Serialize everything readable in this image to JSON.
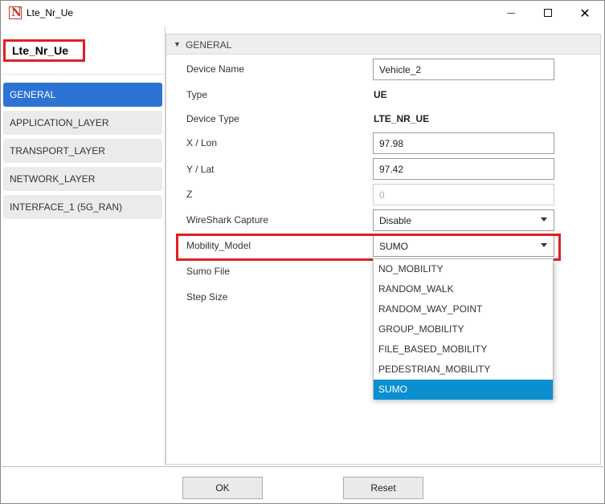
{
  "window": {
    "title": "Lte_Nr_Ue",
    "app_icon_letter": "N",
    "controls": {
      "minimize": "minimize",
      "maximize": "maximize",
      "close": "✕"
    }
  },
  "sidebar": {
    "device_title": "Lte_Nr_Ue",
    "items": [
      {
        "label": "GENERAL",
        "active": true
      },
      {
        "label": "APPLICATION_LAYER",
        "active": false
      },
      {
        "label": "TRANSPORT_LAYER",
        "active": false
      },
      {
        "label": "NETWORK_LAYER",
        "active": false
      },
      {
        "label": "INTERFACE_1 (5G_RAN)",
        "active": false
      }
    ]
  },
  "general": {
    "section_title": "GENERAL",
    "fields": {
      "device_name": {
        "label": "Device Name",
        "value": "Vehicle_2"
      },
      "type": {
        "label": "Type",
        "value": "UE"
      },
      "device_type": {
        "label": "Device Type",
        "value": "LTE_NR_UE"
      },
      "x_lon": {
        "label": "X / Lon",
        "value": "97.98"
      },
      "y_lat": {
        "label": "Y / Lat",
        "value": "97.42"
      },
      "z": {
        "label": "Z",
        "value": "0"
      },
      "wireshark": {
        "label": "WireShark Capture",
        "value": "Disable"
      },
      "mobility_model": {
        "label": "Mobility_Model",
        "value": "SUMO"
      },
      "sumo_file": {
        "label": "Sumo File"
      },
      "step_size": {
        "label": "Step Size"
      }
    },
    "mobility_options": [
      "NO_MOBILITY",
      "RANDOM_WALK",
      "RANDOM_WAY_POINT",
      "GROUP_MOBILITY",
      "FILE_BASED_MOBILITY",
      "PEDESTRIAN_MOBILITY",
      "SUMO"
    ],
    "mobility_selected": "SUMO"
  },
  "footer": {
    "ok_label": "OK",
    "reset_label": "Reset"
  },
  "colors": {
    "accent": "#2d73d4",
    "selected_option": "#0b8fd1",
    "highlight_border": "#e02020"
  }
}
